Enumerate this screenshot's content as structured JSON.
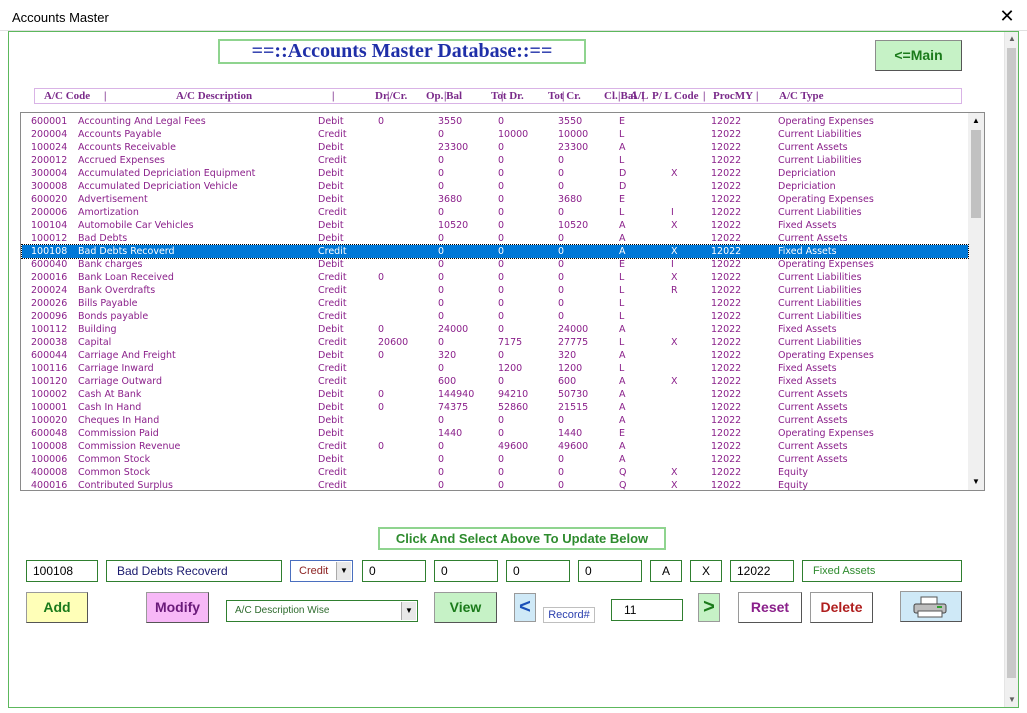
{
  "window": {
    "title": "Accounts Master",
    "close_glyph": "✕"
  },
  "main_title": "==::Accounts Master Database::==",
  "main_button": "<=Main",
  "columns": [
    "A/C Code",
    "|",
    "A/C Description",
    "|",
    "Dr./Cr.",
    "|",
    "Op. Bal",
    "|",
    "Tot Dr.",
    "|",
    "Tot Cr.",
    "|",
    "Cl. Bal",
    "|",
    "A/L",
    "|",
    "P/ L Code",
    "|",
    "ProcMY",
    "|",
    "A/C Type"
  ],
  "rows": [
    [
      "600001",
      "Accounting And Legal Fees",
      "Debit",
      "0",
      "3550",
      "0",
      "3550",
      "E",
      "",
      "12022",
      "Operating Expenses"
    ],
    [
      "200004",
      "Accounts Payable",
      "Credit",
      "",
      "0",
      "10000",
      "10000",
      "L",
      "",
      "12022",
      "Current Liabilities"
    ],
    [
      "100024",
      "Accounts Receivable",
      "Debit",
      "",
      "23300",
      "0",
      "23300",
      "A",
      "",
      "12022",
      "Current Assets"
    ],
    [
      "200012",
      "Accrued Expenses",
      "Credit",
      "",
      "0",
      "0",
      "0",
      "L",
      "",
      "12022",
      "Current Liabilities"
    ],
    [
      "300004",
      "Accumulated Depriciation Equipment",
      "Debit",
      "",
      "0",
      "0",
      "0",
      "D",
      "X",
      "12022",
      "Depriciation"
    ],
    [
      "300008",
      "Accumulated Depriciation Vehicle",
      "Debit",
      "",
      "0",
      "0",
      "0",
      "D",
      "",
      "12022",
      "Depriciation"
    ],
    [
      "600020",
      "Advertisement",
      "Debit",
      "",
      "3680",
      "0",
      "3680",
      "E",
      "",
      "12022",
      "Operating Expenses"
    ],
    [
      "200006",
      "Amortization",
      "Credit",
      "",
      "0",
      "0",
      "0",
      "L",
      "I",
      "12022",
      "Current Liabilities"
    ],
    [
      "100104",
      "Automobile Car Vehicles",
      "Debit",
      "",
      "10520",
      "0",
      "10520",
      "A",
      "X",
      "12022",
      "Fixed Assets"
    ],
    [
      "100012",
      "Bad Debts",
      "Debit",
      "",
      "0",
      "0",
      "0",
      "A",
      "",
      "12022",
      "Current Assets"
    ],
    [
      "100108",
      "Bad Debts Recoverd",
      "Credit",
      "",
      "0",
      "0",
      "0",
      "A",
      "X",
      "12022",
      "Fixed Assets"
    ],
    [
      "600040",
      "Bank charges",
      "Debit",
      "",
      "0",
      "0",
      "0",
      "E",
      "I",
      "12022",
      "Operating Expenses"
    ],
    [
      "200016",
      "Bank Loan Received",
      "Credit",
      "0",
      "0",
      "0",
      "0",
      "L",
      "X",
      "12022",
      "Current Liabilities"
    ],
    [
      "200024",
      "Bank Overdrafts",
      "Credit",
      "",
      "0",
      "0",
      "0",
      "L",
      "R",
      "12022",
      "Current Liabilities"
    ],
    [
      "200026",
      "Bills Payable",
      "Credit",
      "",
      "0",
      "0",
      "0",
      "L",
      "",
      "12022",
      "Current Liabilities"
    ],
    [
      "200096",
      "Bonds payable",
      "Credit",
      "",
      "0",
      "0",
      "0",
      "L",
      "",
      "12022",
      "Current Liabilities"
    ],
    [
      "100112",
      "Building",
      "Debit",
      "0",
      "24000",
      "0",
      "24000",
      "A",
      "",
      "12022",
      "Fixed Assets"
    ],
    [
      "200038",
      "Capital",
      "Credit",
      "20600",
      "0",
      "7175",
      "27775",
      "L",
      "X",
      "12022",
      "Current Liabilities"
    ],
    [
      "600044",
      "Carriage And Freight",
      "Debit",
      "0",
      "320",
      "0",
      "320",
      "A",
      "",
      "12022",
      "Operating Expenses"
    ],
    [
      "100116",
      "Carriage Inward",
      "Credit",
      "",
      "0",
      "1200",
      "1200",
      "L",
      "",
      "12022",
      "Fixed Assets"
    ],
    [
      "100120",
      "Carriage Outward",
      "Credit",
      "",
      "600",
      "0",
      "600",
      "A",
      "X",
      "12022",
      "Fixed Assets"
    ],
    [
      "100002",
      "Cash At Bank",
      "Debit",
      "0",
      "144940",
      "94210",
      "50730",
      "A",
      "",
      "12022",
      "Current Assets"
    ],
    [
      "100001",
      "Cash In Hand",
      "Debit",
      "0",
      "74375",
      "52860",
      "21515",
      "A",
      "",
      "12022",
      "Current Assets"
    ],
    [
      "100020",
      "Cheques In Hand",
      "Debit",
      "",
      "0",
      "0",
      "0",
      "A",
      "",
      "12022",
      "Current Assets"
    ],
    [
      "600048",
      "Commission Paid",
      "Debit",
      "",
      "1440",
      "0",
      "1440",
      "E",
      "",
      "12022",
      "Operating Expenses"
    ],
    [
      "100008",
      "Commission Revenue",
      "Credit",
      "0",
      "0",
      "49600",
      "49600",
      "A",
      "",
      "12022",
      "Current Assets"
    ],
    [
      "100006",
      "Common Stock",
      "Debit",
      "",
      "0",
      "0",
      "0",
      "A",
      "",
      "12022",
      "Current Assets"
    ],
    [
      "400008",
      "Common Stock",
      "Credit",
      "",
      "0",
      "0",
      "0",
      "Q",
      "X",
      "12022",
      "Equity"
    ],
    [
      "400016",
      "Contributed Surplus",
      "Credit",
      "",
      "0",
      "0",
      "0",
      "Q",
      "X",
      "12022",
      "Equity"
    ]
  ],
  "selected_row": 10,
  "hint": "Click And Select Above To Update Below",
  "form": {
    "code": "100108",
    "description": "Bad Debts Recoverd",
    "drcr": "Credit",
    "op_bal": "0",
    "tot_dr": "0",
    "tot_cr": "0",
    "cl_bal": "0",
    "al": "A",
    "pl": "X",
    "procmy": "12022",
    "type": "Fixed Assets"
  },
  "buttons": {
    "add": "Add",
    "modify": "Modify",
    "view": "View",
    "prev": "<",
    "next": ">",
    "reset": "Reset",
    "delete": "Delete"
  },
  "sort_option": "A/C Description Wise",
  "record_label": "Record#",
  "record_number": "11",
  "icons": {
    "dropdown": "▼",
    "scroll_up": "▲",
    "scroll_down": "▼",
    "printer": "printer-icon"
  },
  "colors": {
    "selection": "#0078d7",
    "row_text": "#8a1f8a",
    "title": "#1f2fa8"
  }
}
